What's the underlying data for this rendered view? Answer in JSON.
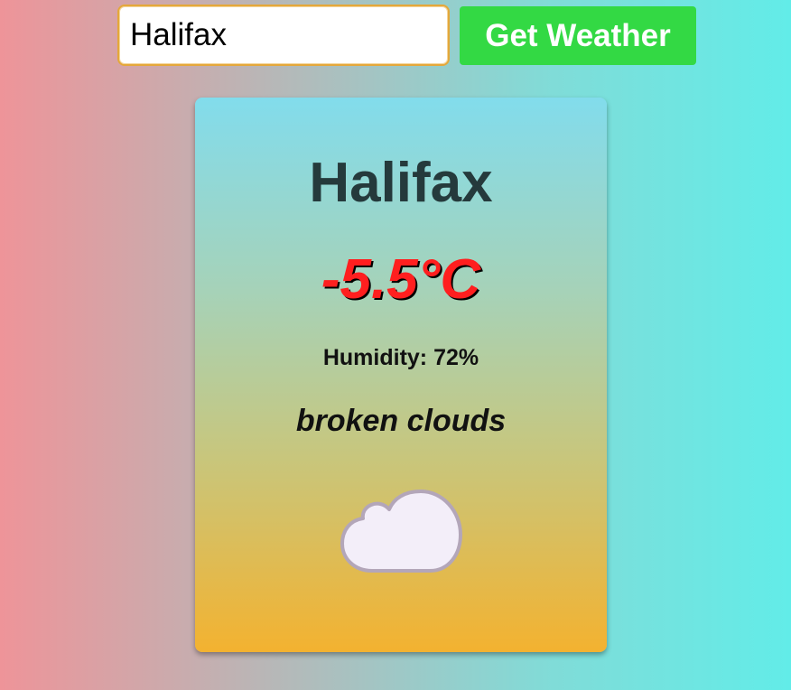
{
  "search": {
    "value": "Halifax",
    "button_label": "Get Weather"
  },
  "weather": {
    "city": "Halifax",
    "temperature": "-5.5°C",
    "humidity_label": "Humidity: 72%",
    "description": "broken clouds",
    "icon": "cloud-icon"
  },
  "colors": {
    "button": "#33d944",
    "temperature": "#ff1f1f",
    "city": "#253a3c",
    "input_border": "#e5a83a"
  }
}
